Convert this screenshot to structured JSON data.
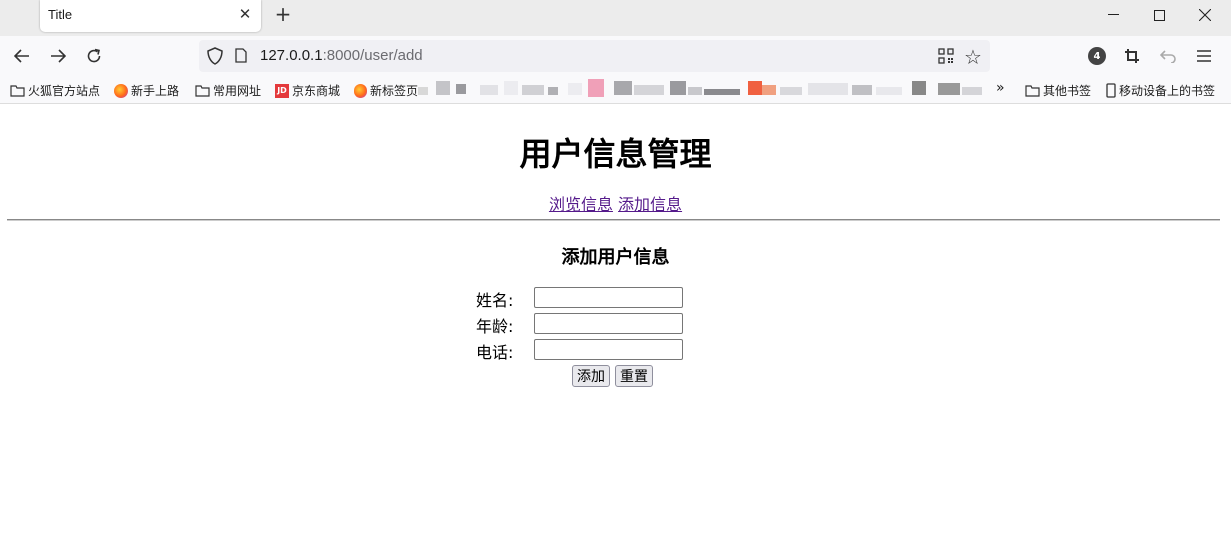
{
  "browser": {
    "tab_title": "Title",
    "url_host": "127.0.0.1",
    "url_rest": ":8000/user/add",
    "badge_count": "4",
    "bookmarks": {
      "items": [
        "火狐官方站点",
        "新手上路",
        "常用网址",
        "京东商城",
        "新标签页"
      ],
      "overflow_label": "»",
      "other_bookmarks": "其他书签",
      "mobile_bookmarks": "移动设备上的书签"
    }
  },
  "page": {
    "title": "用户信息管理",
    "nav": {
      "browse_label": "浏览信息",
      "add_label": "添加信息"
    },
    "form_title": "添加用户信息",
    "fields": {
      "name_label": "姓名:",
      "name_value": "",
      "age_label": "年龄:",
      "age_value": "",
      "phone_label": "电话:",
      "phone_value": ""
    },
    "buttons": {
      "submit_label": "添加",
      "reset_label": "重置"
    }
  },
  "colors": {
    "visited_link": "#551a8b",
    "titlebar": "#ececec",
    "toolbar": "#f9f9fb"
  }
}
